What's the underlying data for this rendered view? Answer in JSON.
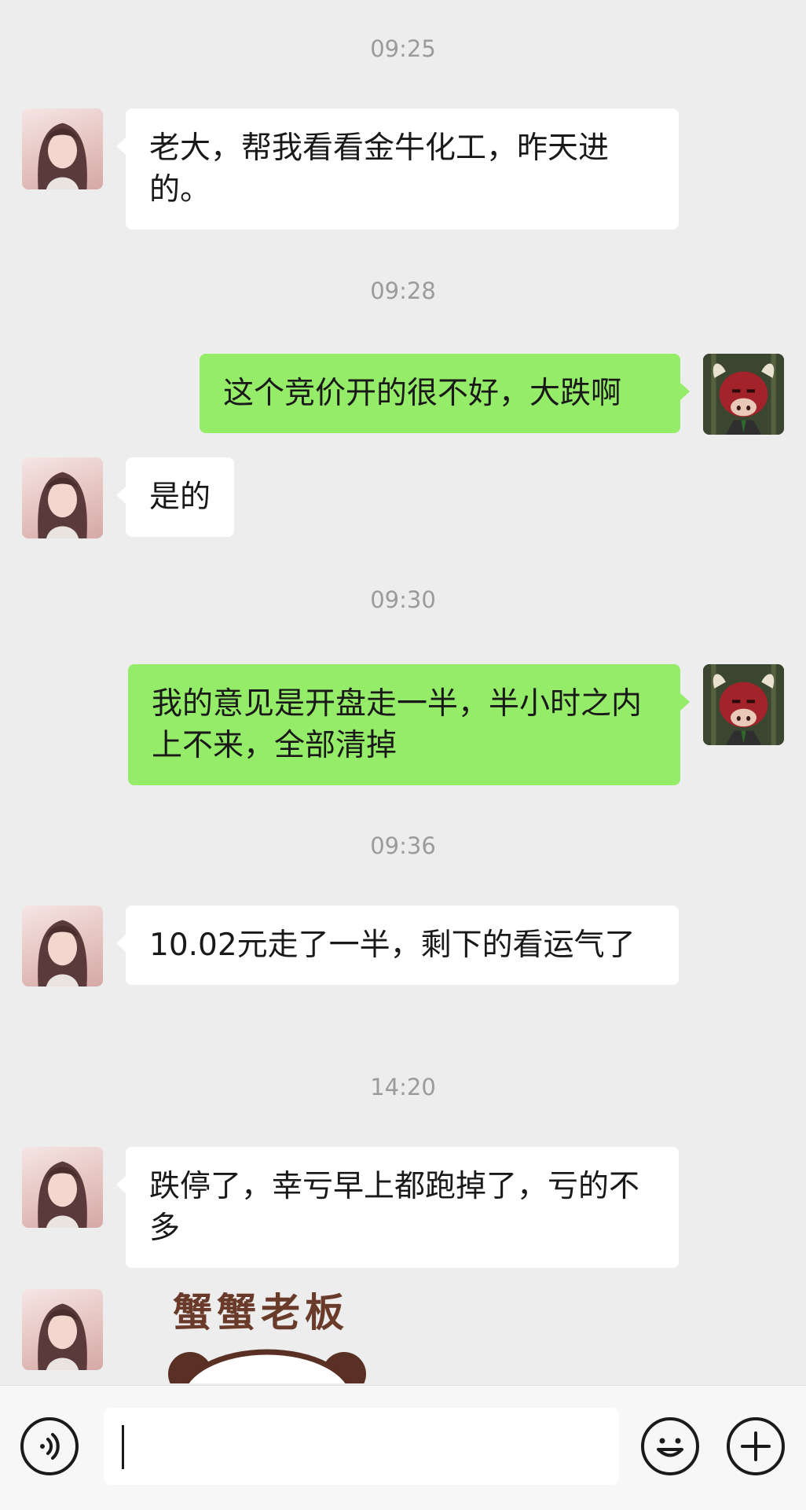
{
  "messages": [
    {
      "type": "time",
      "text": "09:25"
    },
    {
      "type": "left",
      "text": "老大，帮我看看金牛化工，昨天进的。"
    },
    {
      "type": "time",
      "text": "09:28"
    },
    {
      "type": "right",
      "text": "这个竞价开的很不好，大跌啊"
    },
    {
      "type": "left",
      "text": "是的"
    },
    {
      "type": "time",
      "text": "09:30"
    },
    {
      "type": "right",
      "text": "我的意见是开盘走一半，半小时之内上不来，全部清掉"
    },
    {
      "type": "time",
      "text": "09:36"
    },
    {
      "type": "left",
      "text": "10.02元走了一半，剩下的看运气了"
    },
    {
      "type": "time",
      "text": "14:20"
    },
    {
      "type": "left",
      "text": "跌停了，幸亏早上都跑掉了，亏的不多"
    },
    {
      "type": "sticker",
      "text": "蟹蟹老板"
    }
  ],
  "input": {
    "value": "",
    "placeholder": ""
  },
  "icons": {
    "voice": "voice-icon",
    "emoji": "emoji-icon",
    "plus": "plus-icon"
  },
  "colors": {
    "background": "#ededed",
    "sent_bubble": "#95ec69",
    "received_bubble": "#ffffff",
    "timestamp": "#9b9b9b"
  }
}
